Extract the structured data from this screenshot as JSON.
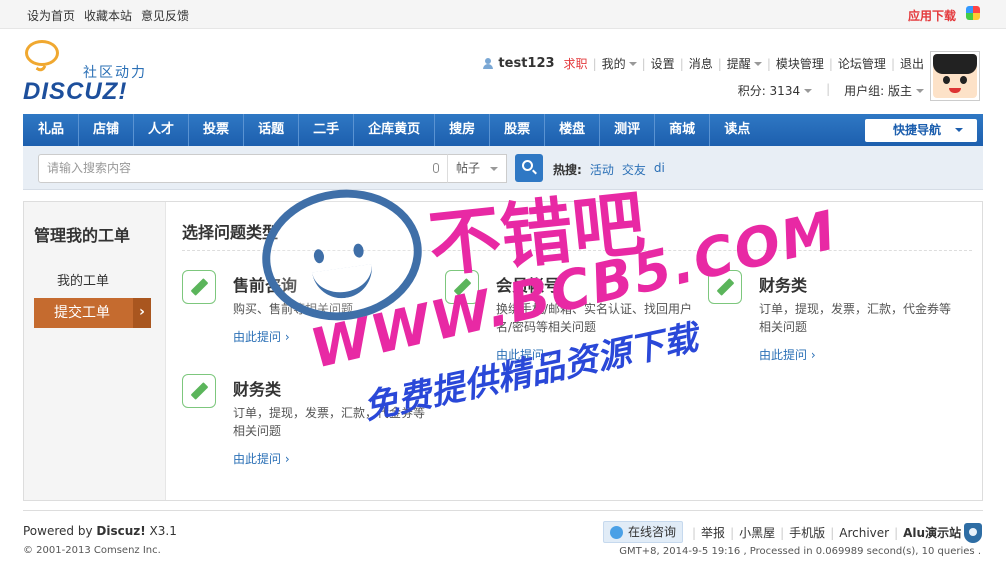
{
  "topbar": {
    "links": [
      "设为首页",
      "收藏本站",
      "意见反馈"
    ],
    "app_download": "应用下载"
  },
  "logo": {
    "cn": "社区动力",
    "en": "DISCUZ!"
  },
  "user": {
    "name": "test123",
    "items": [
      "求职",
      "我的",
      "设置",
      "消息",
      "提醒",
      "模块管理",
      "论坛管理",
      "退出"
    ],
    "points": "积分: 3134",
    "group": "用户组: 版主"
  },
  "nav": {
    "items": [
      "礼品",
      "店铺",
      "人才",
      "投票",
      "话题",
      "二手",
      "企库黄页",
      "搜房",
      "股票",
      "楼盘",
      "测评",
      "商城",
      "读点"
    ],
    "quick": "快捷导航"
  },
  "search": {
    "placeholder": "请输入搜索内容",
    "type": "帖子",
    "hot_label": "热搜:",
    "hot_tags": [
      "活动",
      "交友",
      "di"
    ]
  },
  "sidebar": {
    "title": "管理我的工单",
    "my_tickets": "我的工单",
    "submit": "提交工单"
  },
  "main": {
    "title": "选择问题类型",
    "cards": [
      {
        "name": "售前咨询",
        "desc": "购买、售前等相关问题",
        "more": "由此提问 ›"
      },
      {
        "name": "会员帐号",
        "desc": "换绑手机/邮箱、实名认证、找回用户名/密码等相关问题",
        "more": "由此提问 ›"
      },
      {
        "name": "财务类",
        "desc": "订单，提现，发票，汇款，代金券等相关问题",
        "more": "由此提问 ›"
      },
      {
        "name": "财务类",
        "desc": "订单，提现，发票，汇款，代金券等相关问题",
        "more": "由此提问 ›"
      }
    ]
  },
  "watermark": {
    "title": "不错吧",
    "url": "WWW.BCB5.COM",
    "slogan": "免费提供精品资源下载"
  },
  "footer": {
    "powered_prefix": "Powered by ",
    "powered_brand": "Discuz!",
    "powered_version": " X3.1",
    "copyright": "© 2001-2013 Comsenz Inc.",
    "online": "在线咨询",
    "links": [
      "举报",
      "小黑屋",
      "手机版",
      "Archiver"
    ],
    "site": "Alu演示站",
    "gmt": "GMT+8, 2014-9-5 19:16 , Processed in 0.069989 second(s), 10 queries ."
  }
}
